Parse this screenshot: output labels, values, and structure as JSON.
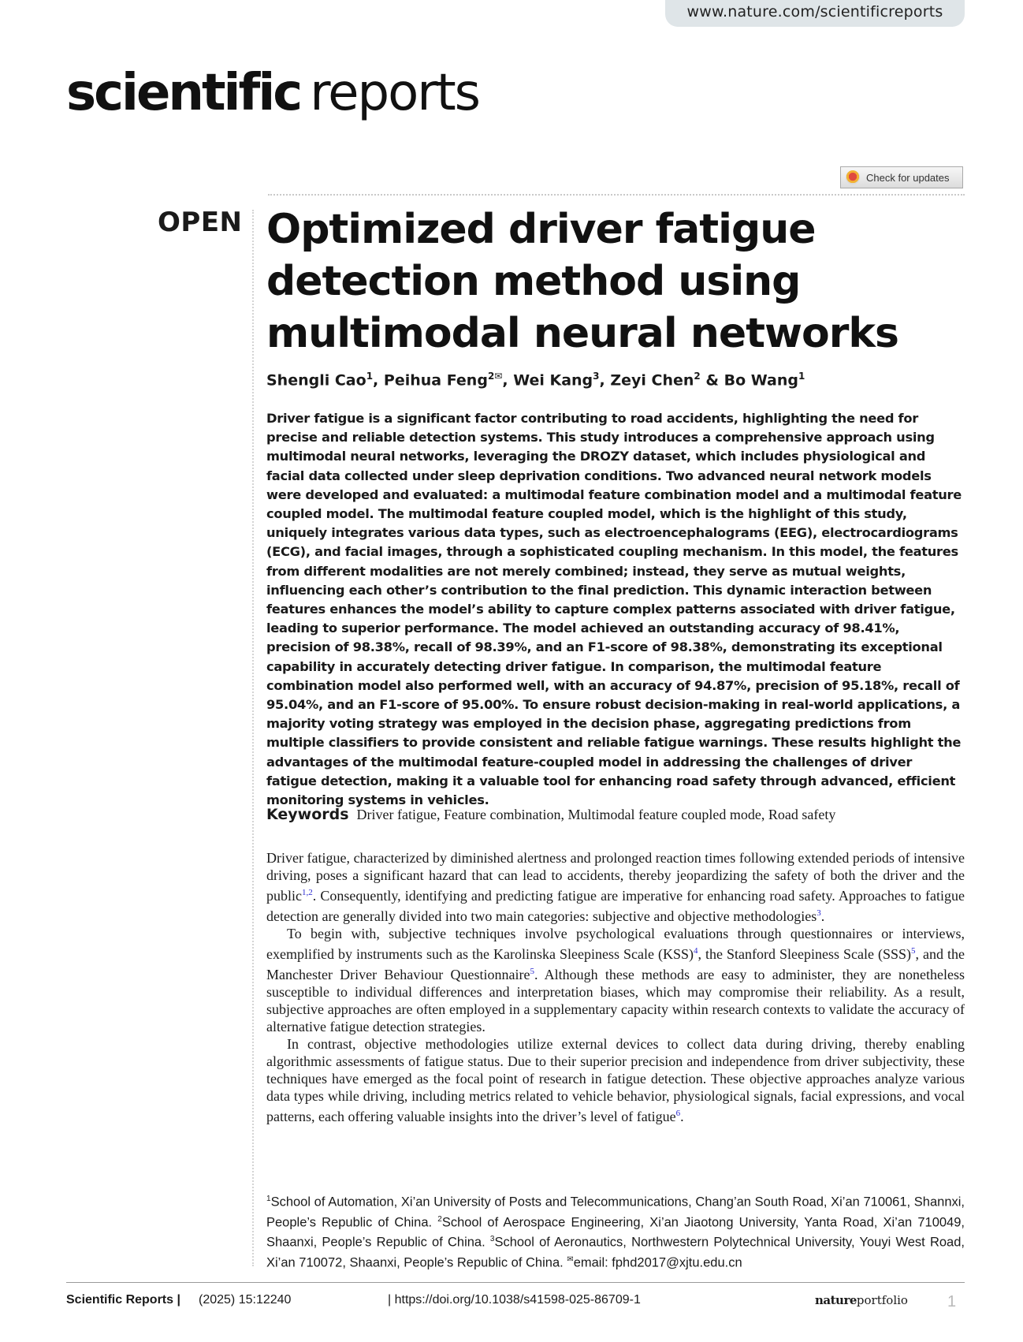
{
  "header": {
    "url": "www.nature.com/scientificreports",
    "logo_bold": "scientific",
    "logo_regular": "reports",
    "check_updates": "Check for updates",
    "open_label": "OPEN"
  },
  "article": {
    "title": "Optimized driver fatigue detection method using multimodal neural networks",
    "authors": [
      {
        "name": "Shengli Cao",
        "sup": "1",
        "sep": ", "
      },
      {
        "name": "Peihua Feng",
        "sup": "2✉",
        "sep": ", "
      },
      {
        "name": "Wei Kang",
        "sup": "3",
        "sep": ", "
      },
      {
        "name": "Zeyi Chen",
        "sup": "2",
        "sep": " & "
      },
      {
        "name": "Bo Wang",
        "sup": "1",
        "sep": ""
      }
    ],
    "abstract": "Driver fatigue is a significant factor contributing to road accidents, highlighting the need for precise and reliable detection systems. This study introduces a comprehensive approach using multimodal neural networks, leveraging the DROZY dataset, which includes physiological and facial data collected under sleep deprivation conditions. Two advanced neural network models were developed and evaluated: a multimodal feature combination model and a multimodal feature coupled model. The multimodal feature coupled model, which is the highlight of this study, uniquely integrates various data types, such as electroencephalograms (EEG), electrocardiograms (ECG), and facial images, through a sophisticated coupling mechanism. In this model, the features from different modalities are not merely combined; instead, they serve as mutual weights, influencing each other’s contribution to the final prediction. This dynamic interaction between features enhances the model’s ability to capture complex patterns associated with driver fatigue, leading to superior performance. The model achieved an outstanding accuracy of 98.41%, precision of 98.38%, recall of 98.39%, and an F1-score of 98.38%, demonstrating its exceptional capability in accurately detecting driver fatigue. In comparison, the multimodal feature combination model also performed well, with an accuracy of 94.87%, precision of 95.18%, recall of 95.04%, and an F1-score of 95.00%. To ensure robust decision-making in real-world applications, a majority voting strategy was employed in the decision phase, aggregating predictions from multiple classifiers to provide consistent and reliable fatigue warnings. These results highlight the advantages of the multimodal feature-coupled model in addressing the challenges of driver fatigue detection, making it a valuable tool for enhancing road safety through advanced, efficient monitoring systems in vehicles.",
    "keywords_label": "Keywords",
    "keywords": "Driver fatigue, Feature combination, Multimodal feature coupled mode, Road safety",
    "paragraphs": [
      {
        "indent": false,
        "parts": [
          {
            "t": "Driver fatigue, characterized by diminished alertness and prolonged reaction times following extended periods of intensive driving, poses a significant hazard that can lead to accidents, thereby jeopardizing the safety of both the driver and the public"
          },
          {
            "ref": "1,2"
          },
          {
            "t": ". Consequently, identifying and predicting fatigue are imperative for enhancing road safety. Approaches to fatigue detection are generally divided into two main categories: subjective and objective methodologies"
          },
          {
            "ref": "3"
          },
          {
            "t": "."
          }
        ]
      },
      {
        "indent": true,
        "parts": [
          {
            "t": "To begin with, subjective techniques involve psychological evaluations through questionnaires or interviews, exemplified by instruments such as the Karolinska Sleepiness Scale (KSS)"
          },
          {
            "ref": "4"
          },
          {
            "t": ", the Stanford Sleepiness Scale (SSS)"
          },
          {
            "ref": "5"
          },
          {
            "t": ", and the Manchester Driver Behaviour Questionnaire"
          },
          {
            "ref": "5"
          },
          {
            "t": ". Although these methods are easy to administer, they are nonetheless susceptible to individual differences and interpretation biases, which may compromise their reliability. As a result, subjective approaches are often employed in a supplementary capacity within research contexts to validate the accuracy of alternative fatigue detection strategies."
          }
        ]
      },
      {
        "indent": true,
        "parts": [
          {
            "t": "In contrast, objective methodologies utilize external devices to collect data during driving, thereby enabling algorithmic assessments of fatigue status. Due to their superior precision and independence from driver subjectivity, these techniques have emerged as the focal point of research in fatigue detection. These objective approaches analyze various data types while driving, including metrics related to vehicle behavior, physiological signals, facial expressions, and vocal patterns, each offering valuable insights into the driver’s level of fatigue"
          },
          {
            "ref": "6"
          },
          {
            "t": "."
          }
        ]
      }
    ],
    "affiliations": [
      {
        "sup": "1",
        "t": "School of Automation, Xi’an University of Posts and Telecommunications, Chang’an South Road, Xi’an 710061, Shannxi, People’s Republic of China. "
      },
      {
        "sup": "2",
        "t": "School of Aerospace Engineering, Xi’an Jiaotong University, Yanta Road, Xi’an 710049, Shaanxi, People’s Republic of China. "
      },
      {
        "sup": "3",
        "t": "School of Aeronautics, Northwestern Polytechnical University, Youyi West Road, Xi’an 710072, Shaanxi, People’s Republic of China. "
      },
      {
        "sup": "✉",
        "t": "email: fphd2017@xjtu.edu.cn"
      }
    ]
  },
  "footer": {
    "journal": "Scientific Reports |",
    "citation": "(2025) 15:12240",
    "doi": "| https://doi.org/10.1038/s41598-025-86709-1",
    "brand_bold": "nature",
    "brand_regular": "portfolio",
    "page": "1"
  }
}
